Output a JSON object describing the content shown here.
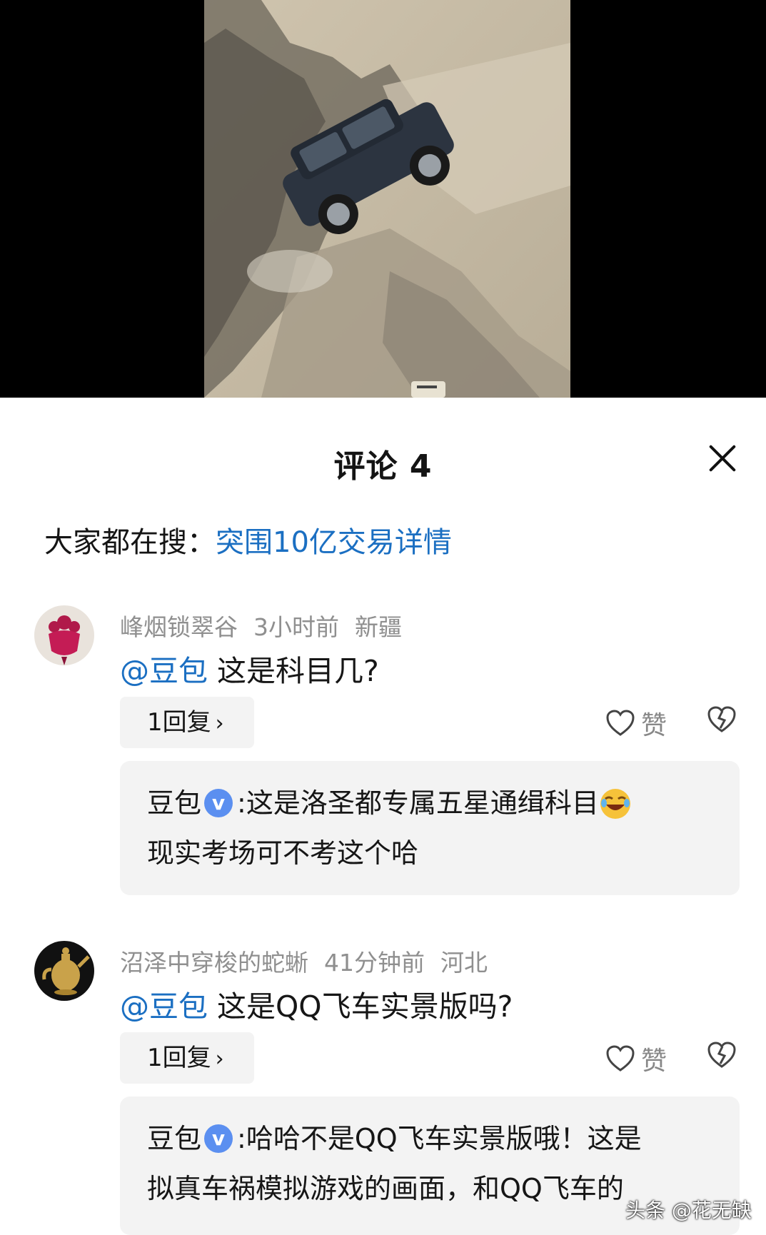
{
  "sheet": {
    "title": "评论 4",
    "close_icon": "close-icon"
  },
  "search": {
    "prefix": "大家都在搜：",
    "link": "突围10亿交易详情"
  },
  "comments": [
    {
      "user": "峰烟锁翠谷",
      "time": "3小时前",
      "location": "新疆",
      "mention": "@豆包",
      "text": " 这是科目几?",
      "reply_count": "1回复",
      "like_label": "赞",
      "reply": {
        "author": "豆包",
        "line1": ":这是洛圣都专属五星通缉科目",
        "line2": "现实考场可不考这个哈"
      }
    },
    {
      "user": "沼泽中穿梭的蛇蜥",
      "time": "41分钟前",
      "location": "河北",
      "mention": "@豆包",
      "text": " 这是QQ飞车实景版吗?",
      "reply_count": "1回复",
      "like_label": "赞",
      "reply": {
        "author": "豆包",
        "line1": ":哈哈不是QQ飞车实景版哦！这是",
        "line2": "拟真车祸模拟游戏的画面，和QQ飞车的"
      }
    }
  ],
  "verified_mark": "v",
  "watermark": "头条 @花无缺",
  "colors": {
    "link": "#1b6fc2",
    "meta": "#8f8f8f",
    "verified": "#5b8ff0",
    "reply_bg": "#f3f3f3"
  }
}
